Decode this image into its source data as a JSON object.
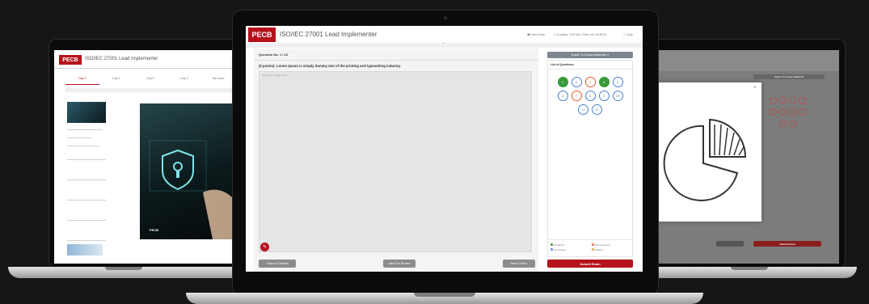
{
  "app": {
    "brand": "PECB",
    "title": "ISO/IEC 27001 Lead Implementer",
    "title_left": "ISO/IEC 27001 Lead Implementer"
  },
  "header": {
    "need_help": "Need Help",
    "duration": "Duration: 3:00 Min | Time Left: 00:59:01",
    "help": "Help"
  },
  "question": {
    "number": "Question No. 1 / 10",
    "text": "(5 points): Lorem Ipsum is simply dummy text of the printing and typesetting industry.",
    "answer_placeholder": "Type your answer here..."
  },
  "nav": {
    "prev": "Save & Previous",
    "mark": "Mark For Review",
    "next": "Save & Next"
  },
  "side": {
    "switch": "Switch To Course Materials",
    "list_title": "List of Questions",
    "questions": [
      {
        "n": "1",
        "state": "answered"
      },
      {
        "n": "2",
        "state": "not-visited"
      },
      {
        "n": "3",
        "state": "not-answered"
      },
      {
        "n": "4",
        "state": "answered"
      },
      {
        "n": "5",
        "state": "not-visited"
      },
      {
        "n": "6",
        "state": "not-visited"
      },
      {
        "n": "7",
        "state": "not-answered"
      },
      {
        "n": "8",
        "state": "not-visited"
      },
      {
        "n": "9",
        "state": "not-visited"
      },
      {
        "n": "10",
        "state": "not-visited"
      },
      {
        "n": "11",
        "state": "not-visited"
      },
      {
        "n": "12",
        "state": "not-visited"
      }
    ],
    "legend": {
      "answered": "Answered",
      "not_answered": "Not Answered",
      "not_visited": "Not Visited",
      "marked": "Marked"
    },
    "submit": "Submit Exam"
  },
  "left_tabs": [
    "Day 1",
    "Day 2",
    "Day 3",
    "Day 4",
    "My Notes"
  ],
  "left_page": "PECB",
  "colors": {
    "brand_red": "#b5121b",
    "answered": "#3a9a3a",
    "not_answered": "#e05a2a",
    "not_visited": "#4a7fd0",
    "marked": "#e0a020"
  }
}
